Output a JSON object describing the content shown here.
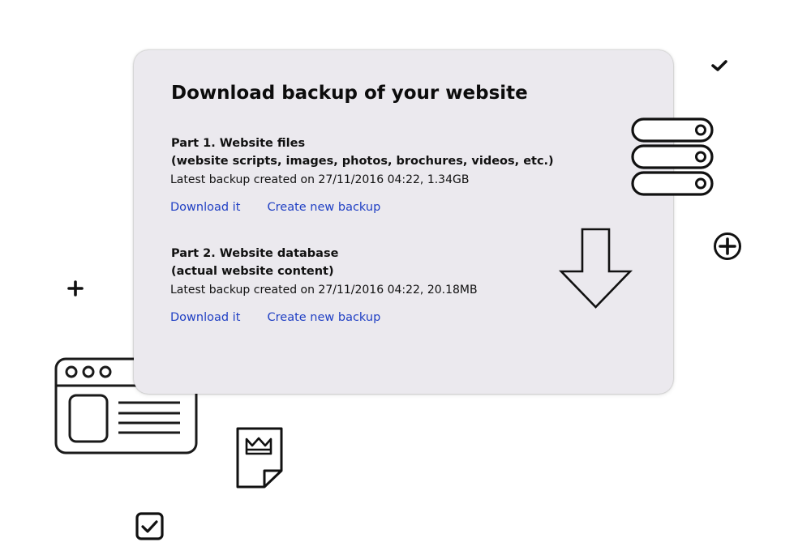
{
  "title": "Download backup of your website",
  "sections": [
    {
      "heading_line1": "Part 1. Website files",
      "heading_line2": "(website scripts, images, photos, brochures, videos, etc.)",
      "info": "Latest backup created on 27/11/2016 04:22, 1.34GB",
      "download_label": "Download it",
      "create_label": "Create new backup"
    },
    {
      "heading_line1": "Part 2. Website database",
      "heading_line2": "(actual website content)",
      "info": "Latest backup created on 27/11/2016 04:22, 20.18MB",
      "download_label": "Download it",
      "create_label": "Create new backup"
    }
  ],
  "icons": {
    "server": "server-stack-icon",
    "download_arrow": "download-arrow-icon",
    "check": "checkmark-icon",
    "plus": "plus-icon",
    "plus_circle": "plus-circle-icon",
    "browser": "browser-window-icon",
    "document": "crown-document-icon",
    "checkbox": "checked-checkbox-icon"
  },
  "colors": {
    "card_bg": "#ebe9ee",
    "link": "#1f3fc4",
    "text": "#111111"
  }
}
